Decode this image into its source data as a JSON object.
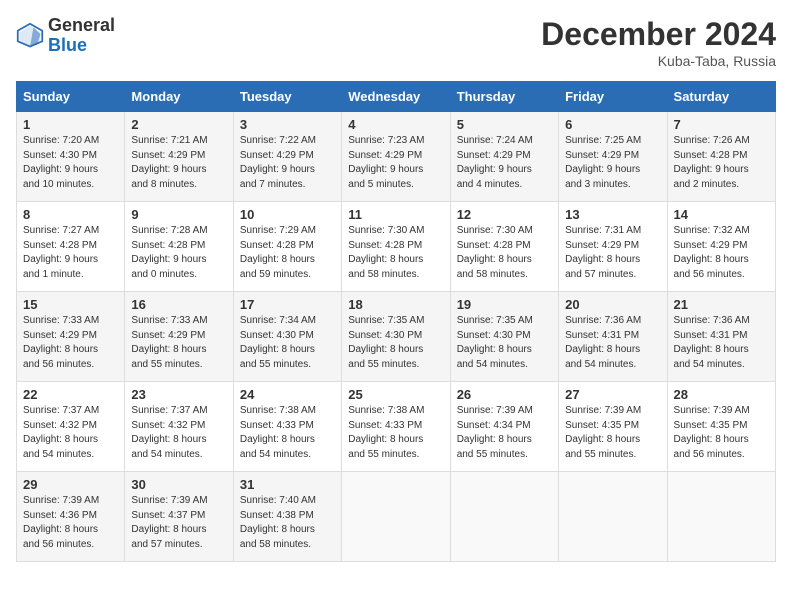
{
  "logo": {
    "general": "General",
    "blue": "Blue"
  },
  "title": "December 2024",
  "subtitle": "Kuba-Taba, Russia",
  "days_of_week": [
    "Sunday",
    "Monday",
    "Tuesday",
    "Wednesday",
    "Thursday",
    "Friday",
    "Saturday"
  ],
  "weeks": [
    [
      {
        "day": "1",
        "info": "Sunrise: 7:20 AM\nSunset: 4:30 PM\nDaylight: 9 hours\nand 10 minutes."
      },
      {
        "day": "2",
        "info": "Sunrise: 7:21 AM\nSunset: 4:29 PM\nDaylight: 9 hours\nand 8 minutes."
      },
      {
        "day": "3",
        "info": "Sunrise: 7:22 AM\nSunset: 4:29 PM\nDaylight: 9 hours\nand 7 minutes."
      },
      {
        "day": "4",
        "info": "Sunrise: 7:23 AM\nSunset: 4:29 PM\nDaylight: 9 hours\nand 5 minutes."
      },
      {
        "day": "5",
        "info": "Sunrise: 7:24 AM\nSunset: 4:29 PM\nDaylight: 9 hours\nand 4 minutes."
      },
      {
        "day": "6",
        "info": "Sunrise: 7:25 AM\nSunset: 4:29 PM\nDaylight: 9 hours\nand 3 minutes."
      },
      {
        "day": "7",
        "info": "Sunrise: 7:26 AM\nSunset: 4:28 PM\nDaylight: 9 hours\nand 2 minutes."
      }
    ],
    [
      {
        "day": "8",
        "info": "Sunrise: 7:27 AM\nSunset: 4:28 PM\nDaylight: 9 hours\nand 1 minute."
      },
      {
        "day": "9",
        "info": "Sunrise: 7:28 AM\nSunset: 4:28 PM\nDaylight: 9 hours\nand 0 minutes."
      },
      {
        "day": "10",
        "info": "Sunrise: 7:29 AM\nSunset: 4:28 PM\nDaylight: 8 hours\nand 59 minutes."
      },
      {
        "day": "11",
        "info": "Sunrise: 7:30 AM\nSunset: 4:28 PM\nDaylight: 8 hours\nand 58 minutes."
      },
      {
        "day": "12",
        "info": "Sunrise: 7:30 AM\nSunset: 4:28 PM\nDaylight: 8 hours\nand 58 minutes."
      },
      {
        "day": "13",
        "info": "Sunrise: 7:31 AM\nSunset: 4:29 PM\nDaylight: 8 hours\nand 57 minutes."
      },
      {
        "day": "14",
        "info": "Sunrise: 7:32 AM\nSunset: 4:29 PM\nDaylight: 8 hours\nand 56 minutes."
      }
    ],
    [
      {
        "day": "15",
        "info": "Sunrise: 7:33 AM\nSunset: 4:29 PM\nDaylight: 8 hours\nand 56 minutes."
      },
      {
        "day": "16",
        "info": "Sunrise: 7:33 AM\nSunset: 4:29 PM\nDaylight: 8 hours\nand 55 minutes."
      },
      {
        "day": "17",
        "info": "Sunrise: 7:34 AM\nSunset: 4:30 PM\nDaylight: 8 hours\nand 55 minutes."
      },
      {
        "day": "18",
        "info": "Sunrise: 7:35 AM\nSunset: 4:30 PM\nDaylight: 8 hours\nand 55 minutes."
      },
      {
        "day": "19",
        "info": "Sunrise: 7:35 AM\nSunset: 4:30 PM\nDaylight: 8 hours\nand 54 minutes."
      },
      {
        "day": "20",
        "info": "Sunrise: 7:36 AM\nSunset: 4:31 PM\nDaylight: 8 hours\nand 54 minutes."
      },
      {
        "day": "21",
        "info": "Sunrise: 7:36 AM\nSunset: 4:31 PM\nDaylight: 8 hours\nand 54 minutes."
      }
    ],
    [
      {
        "day": "22",
        "info": "Sunrise: 7:37 AM\nSunset: 4:32 PM\nDaylight: 8 hours\nand 54 minutes."
      },
      {
        "day": "23",
        "info": "Sunrise: 7:37 AM\nSunset: 4:32 PM\nDaylight: 8 hours\nand 54 minutes."
      },
      {
        "day": "24",
        "info": "Sunrise: 7:38 AM\nSunset: 4:33 PM\nDaylight: 8 hours\nand 54 minutes."
      },
      {
        "day": "25",
        "info": "Sunrise: 7:38 AM\nSunset: 4:33 PM\nDaylight: 8 hours\nand 55 minutes."
      },
      {
        "day": "26",
        "info": "Sunrise: 7:39 AM\nSunset: 4:34 PM\nDaylight: 8 hours\nand 55 minutes."
      },
      {
        "day": "27",
        "info": "Sunrise: 7:39 AM\nSunset: 4:35 PM\nDaylight: 8 hours\nand 55 minutes."
      },
      {
        "day": "28",
        "info": "Sunrise: 7:39 AM\nSunset: 4:35 PM\nDaylight: 8 hours\nand 56 minutes."
      }
    ],
    [
      {
        "day": "29",
        "info": "Sunrise: 7:39 AM\nSunset: 4:36 PM\nDaylight: 8 hours\nand 56 minutes."
      },
      {
        "day": "30",
        "info": "Sunrise: 7:39 AM\nSunset: 4:37 PM\nDaylight: 8 hours\nand 57 minutes."
      },
      {
        "day": "31",
        "info": "Sunrise: 7:40 AM\nSunset: 4:38 PM\nDaylight: 8 hours\nand 58 minutes."
      },
      {
        "day": "",
        "info": ""
      },
      {
        "day": "",
        "info": ""
      },
      {
        "day": "",
        "info": ""
      },
      {
        "day": "",
        "info": ""
      }
    ]
  ]
}
